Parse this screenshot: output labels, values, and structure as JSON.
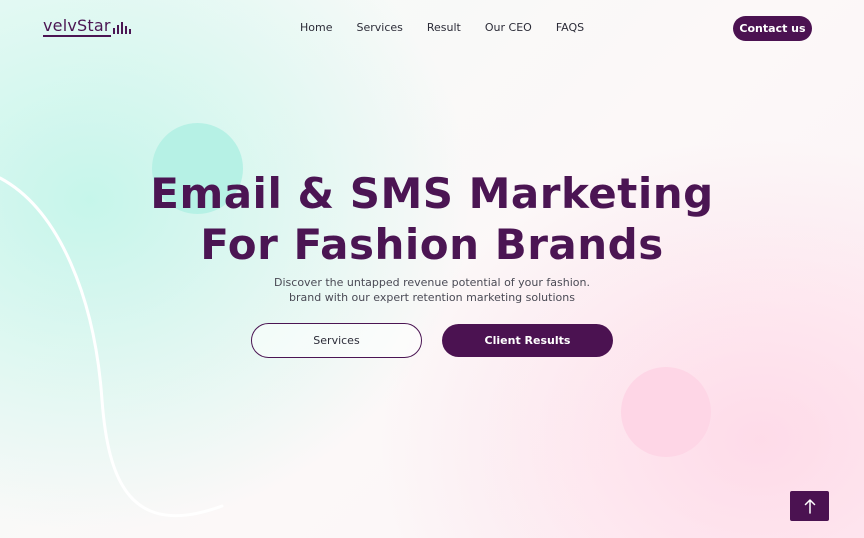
{
  "brand": {
    "logo_text": "velvStar",
    "logo_icon": "sound-bars-icon"
  },
  "nav": {
    "items": [
      {
        "label": "Home"
      },
      {
        "label": "Services"
      },
      {
        "label": "Result"
      },
      {
        "label": "Our CEO"
      },
      {
        "label": "FAQS"
      }
    ],
    "contact_label": "Contact us"
  },
  "hero": {
    "title_line1": "Email & SMS Marketing",
    "title_line2": "For Fashion Brands",
    "subtitle_line1": "Discover the untapped revenue potential of your fashion.",
    "subtitle_line2": "brand with our expert retention marketing solutions",
    "primary_button": "Services",
    "secondary_button": "Client Results"
  },
  "scroll_top": {
    "icon": "arrow-up-icon"
  },
  "colors": {
    "brand": "#4b1553",
    "teal_blob": "#b6f1e5",
    "pink_blob": "#fed6e6"
  }
}
